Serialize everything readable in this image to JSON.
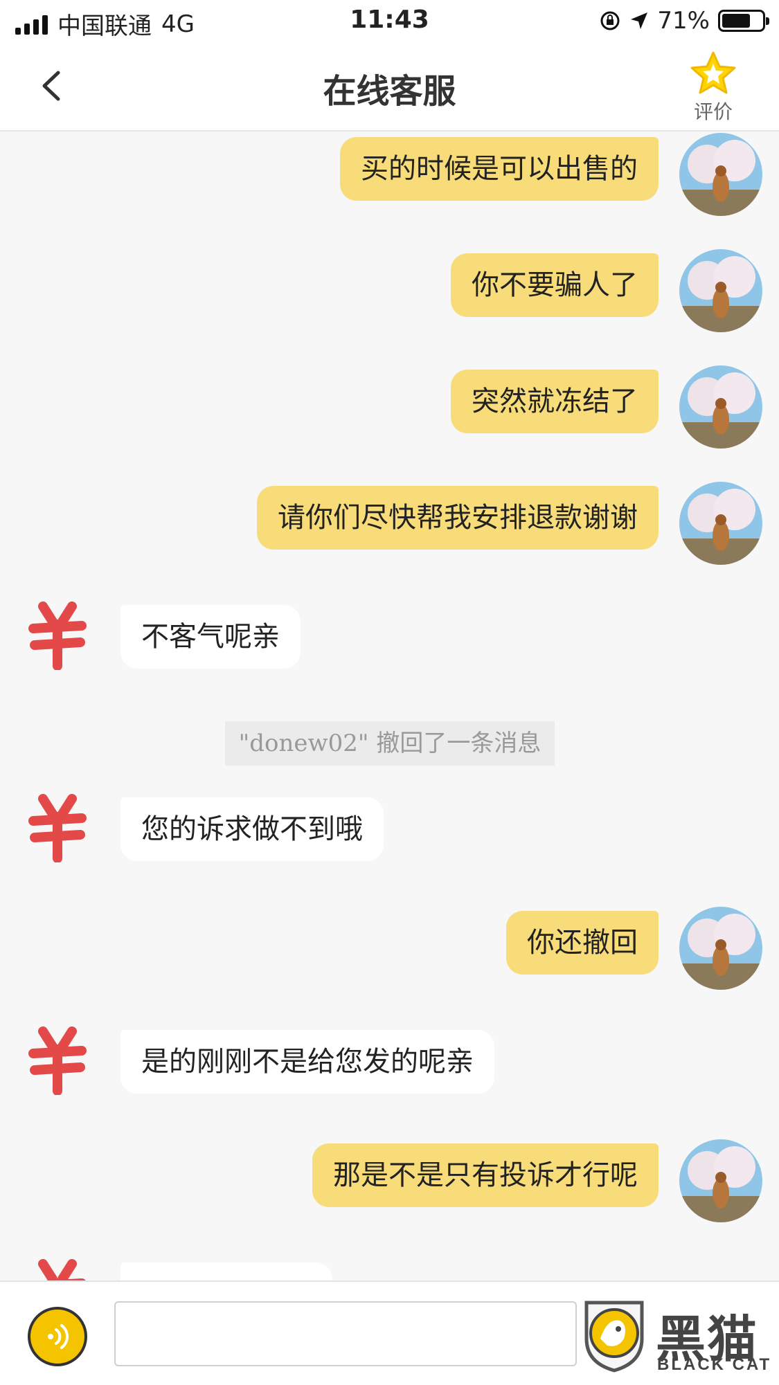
{
  "status_bar": {
    "carrier": "中国联通",
    "network": "4G",
    "time": "11:43",
    "battery": "71%",
    "battery_level": 0.71
  },
  "nav": {
    "title": "在线客服",
    "rate_label": "评价"
  },
  "messages": [
    {
      "from": "me",
      "text": "买的时候是可以出售的"
    },
    {
      "from": "me",
      "text": "你不要骗人了"
    },
    {
      "from": "me",
      "text": "突然就冻结了"
    },
    {
      "from": "me",
      "text": "请你们尽快帮我安排退款谢谢"
    },
    {
      "from": "cs",
      "text": "不客气呢亲"
    },
    {
      "from": "system",
      "text": "\"donew02\" 撤回了一条消息"
    },
    {
      "from": "cs",
      "text": "您的诉求做不到哦"
    },
    {
      "from": "me",
      "text": "你还撤回"
    },
    {
      "from": "cs",
      "text": "是的刚刚不是给您发的呢亲"
    },
    {
      "from": "me",
      "text": "那是不是只有投诉才行呢"
    }
  ],
  "watermark": {
    "cn": "黑猫",
    "en": "BLACK CAT"
  },
  "colors": {
    "my_bubble": "#f8dc7a",
    "cs_bubble": "#ffffff",
    "accent": "#f5c400",
    "cs_avatar": "#e23b3b"
  },
  "icons": [
    "back-chevron-icon",
    "star-icon",
    "voice-icon",
    "black-cat-logo"
  ]
}
